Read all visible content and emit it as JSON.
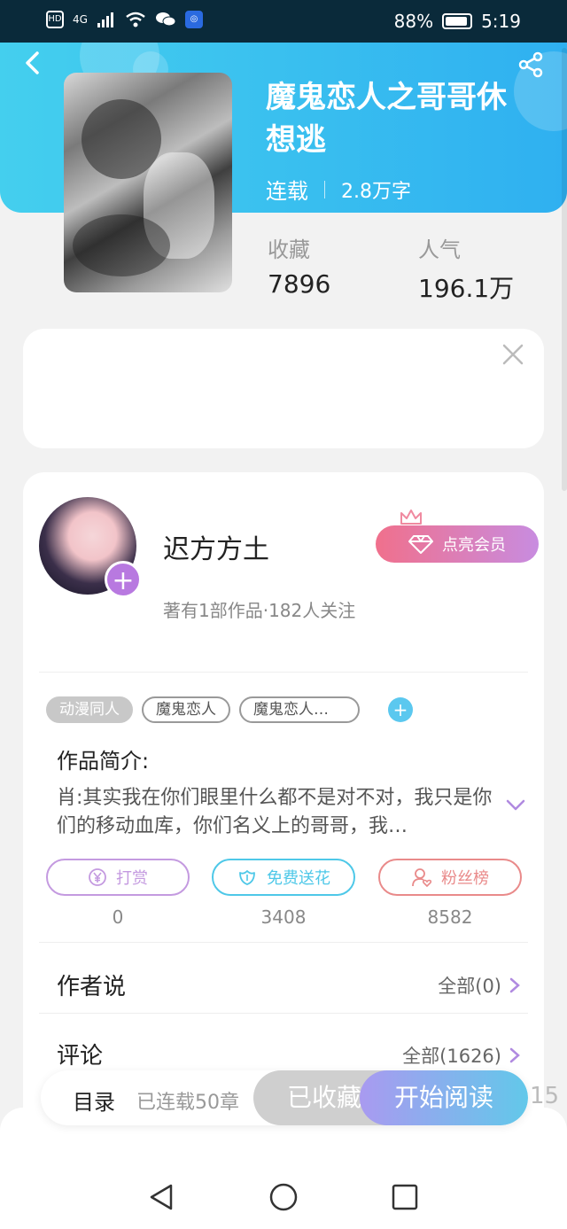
{
  "status_bar": {
    "network_badge": "HD",
    "signal_label": "4G",
    "battery_percent": "88%",
    "time": "5:19"
  },
  "book": {
    "title": "魔鬼恋人之哥哥休想逃",
    "status": "连载",
    "word_count": "2.8万字",
    "stats": {
      "favorites_label": "收藏",
      "favorites_value": "7896",
      "popularity_label": "人气",
      "popularity_value": "196.1万"
    }
  },
  "author": {
    "name": "迟方方土",
    "subtitle": "著有1部作品·182人关注",
    "vip_label": "点亮会员"
  },
  "tags": [
    "动漫同人",
    "魔鬼恋人",
    "魔鬼恋人…"
  ],
  "intro": {
    "label": "作品简介:",
    "text": "肖:其实我在你们眼里什么都不是对不对，我只是你们的移动血库，你们名义上的哥哥，我…"
  },
  "actions": [
    {
      "label": "打赏",
      "count": "0",
      "icon": "yen-icon",
      "color": "#c49ae0"
    },
    {
      "label": "免费送花",
      "count": "3408",
      "icon": "flower-icon",
      "color": "#4ec8e8"
    },
    {
      "label": "粉丝榜",
      "count": "8582",
      "icon": "fan-icon",
      "color": "#e98a8a"
    }
  ],
  "sections": {
    "author_says_label": "作者说",
    "author_says_link": "全部(0)",
    "comments_label": "评论",
    "comments_link": "全部(1626)"
  },
  "bottom_bar": {
    "catalog_label": "目录",
    "catalog_count": "已连载50章",
    "collected_label": "已收藏",
    "read_label": "开始阅读",
    "side_number": "15"
  },
  "colors": {
    "header_gradient_start": "#44cfee",
    "header_gradient_end": "#2fb0f0",
    "vip_gradient_start": "#f0708c",
    "vip_gradient_end": "#c88ce0"
  }
}
